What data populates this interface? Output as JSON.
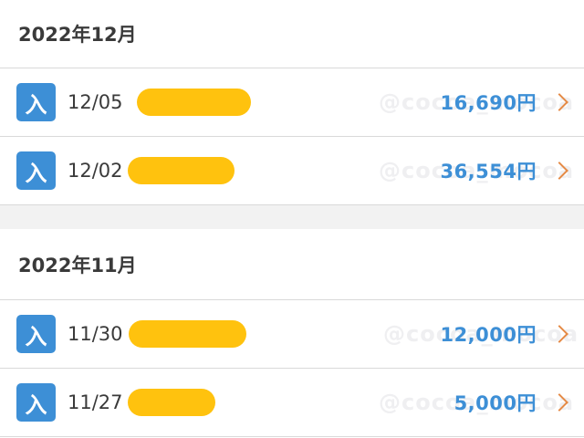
{
  "watermark": "@cocoa_mocoa",
  "sections": [
    {
      "month": "2022年12月",
      "rows": [
        {
          "badge": "入",
          "date": "12/05",
          "amount": "16,690円"
        },
        {
          "badge": "入",
          "date": "12/02",
          "amount": "36,554円"
        }
      ]
    },
    {
      "month": "2022年11月",
      "rows": [
        {
          "badge": "入",
          "date": "11/30",
          "amount": "12,000円"
        },
        {
          "badge": "入",
          "date": "11/27",
          "amount": "5,000円"
        }
      ]
    }
  ],
  "icons": {
    "row_chevron": "chevron-right-icon"
  },
  "colors": {
    "badge": "#3d8fd6",
    "amount": "#3d8fd6",
    "chevron": "#e58a45",
    "redaction": "#ffc20e"
  }
}
